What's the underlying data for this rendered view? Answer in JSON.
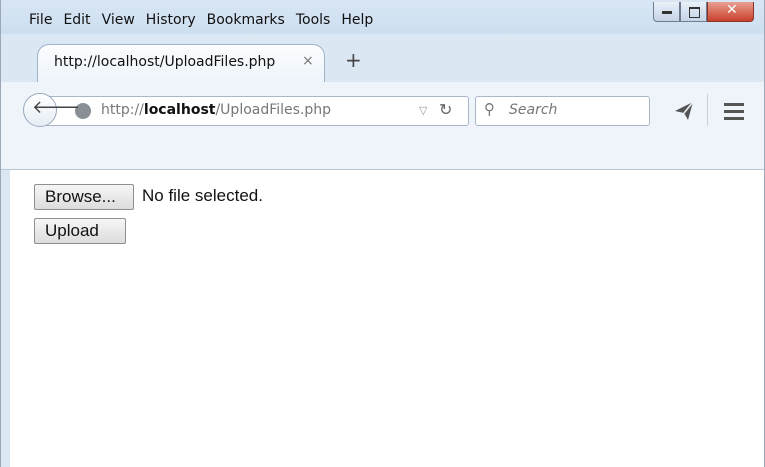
{
  "menu": [
    "File",
    "Edit",
    "View",
    "History",
    "Bookmarks",
    "Tools",
    "Help"
  ],
  "window_controls": {
    "minimize": "minimize-icon",
    "maximize": "maximize-icon",
    "close": "close-icon"
  },
  "tab": {
    "title": "http://localhost/UploadFiles.php",
    "close_glyph": "×",
    "new_tab_glyph": "+"
  },
  "navbar": {
    "url_prefix": "http://",
    "url_host": "localhost",
    "url_path": "/UploadFiles.php",
    "search_placeholder": "Search"
  },
  "form": {
    "browse_label": "Browse...",
    "file_status": "No file selected.",
    "upload_label": "Upload"
  },
  "colors": {
    "chrome": "#dbe7f3",
    "close_button": "#c8412c"
  }
}
